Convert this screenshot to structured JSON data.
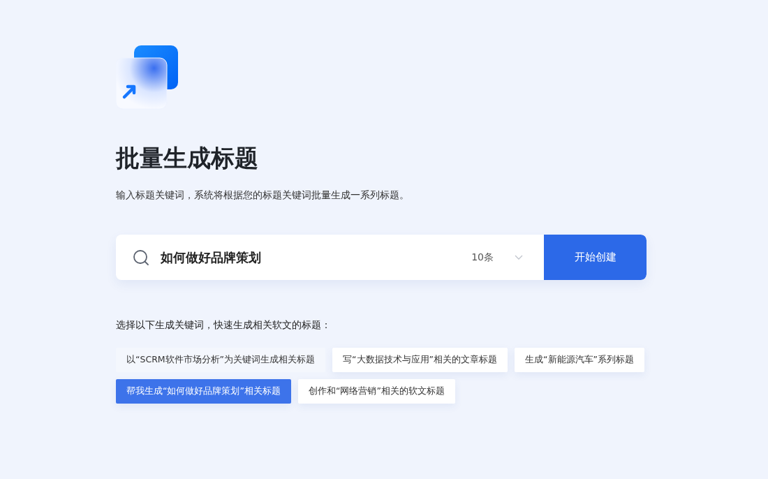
{
  "title": "批量生成标题",
  "subtitle": "输入标题关键词，系统将根据您的标题关键词批量生成一系列标题。",
  "search": {
    "value": "如何做好品牌策划",
    "count": "10条",
    "button": "开始创建"
  },
  "suggestions_label": "选择以下生成关键词，快速生成相关软文的标题：",
  "suggestions": [
    {
      "label": "以“SCRM软件市场分析”为关键词生成相关标题",
      "selected": false,
      "muted": true
    },
    {
      "label": "写“大数据技术与应用”相关的文章标题",
      "selected": false,
      "muted": false
    },
    {
      "label": "生成“新能源汽车”系列标题",
      "selected": false,
      "muted": false
    },
    {
      "label": "帮我生成“如何做好品牌策划”相关标题",
      "selected": true,
      "muted": false
    },
    {
      "label": "创作和“网络营销”相关的软文标题",
      "selected": false,
      "muted": false
    }
  ]
}
